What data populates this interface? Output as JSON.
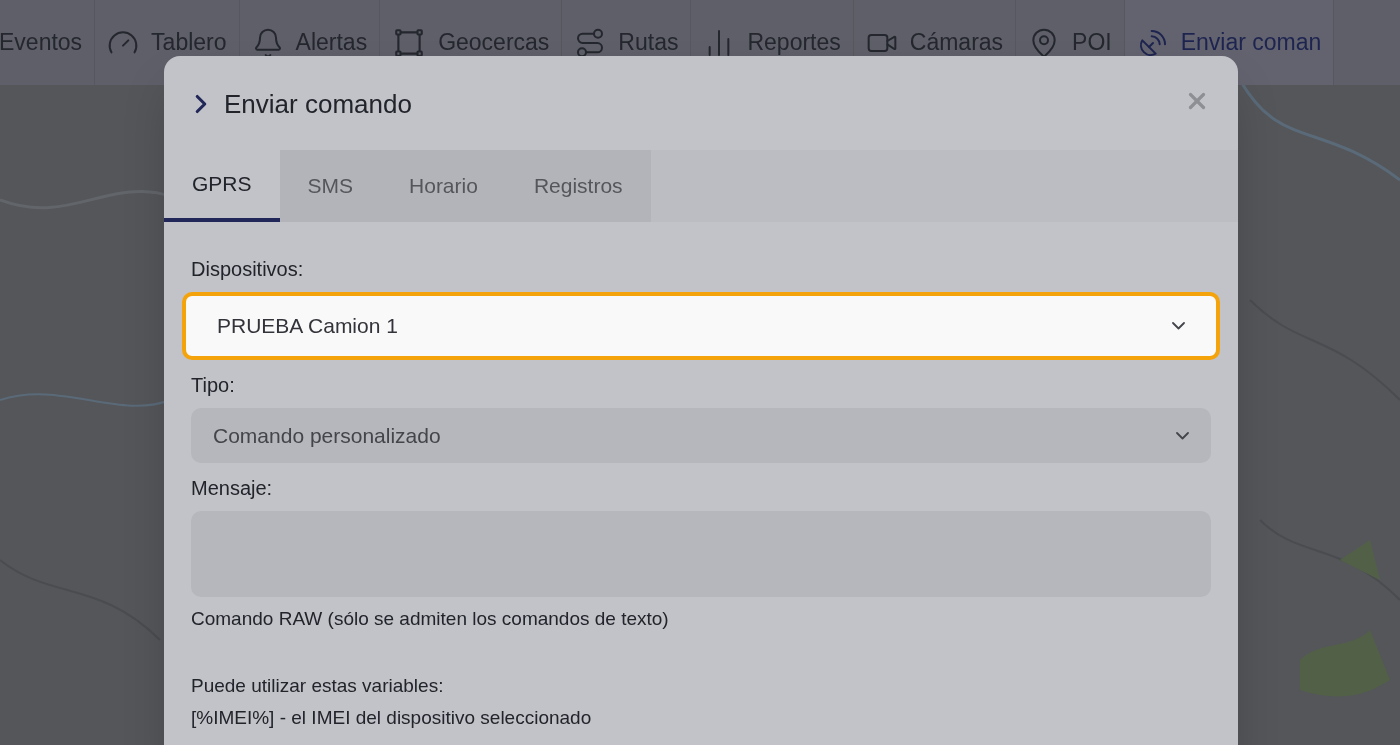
{
  "nav": {
    "items": [
      {
        "label": "Eventos",
        "selected": false
      },
      {
        "label": "Tablero",
        "selected": false
      },
      {
        "label": "Alertas",
        "selected": false
      },
      {
        "label": "Geocercas",
        "selected": false
      },
      {
        "label": "Rutas",
        "selected": false
      },
      {
        "label": "Reportes",
        "selected": false
      },
      {
        "label": "Cámaras",
        "selected": false
      },
      {
        "label": "POI",
        "selected": false
      },
      {
        "label": "Enviar coman",
        "selected": true
      }
    ]
  },
  "dialog": {
    "title": "Enviar comando",
    "tabs": [
      {
        "label": "GPRS",
        "selected": true
      },
      {
        "label": "SMS",
        "selected": false
      },
      {
        "label": "Horario",
        "selected": false
      },
      {
        "label": "Registros",
        "selected": false
      }
    ],
    "fields": [
      {
        "kind": "select",
        "label": "Dispositivos:",
        "value": "PRUEBA Camion 1",
        "focused": true
      },
      {
        "kind": "select",
        "label": "Tipo:",
        "value": "Comando personalizado",
        "focused": false
      },
      {
        "kind": "textarea",
        "label": "Mensaje:",
        "focused": false
      }
    ],
    "hint": "Comando RAW (sólo se admiten los comandos de texto)",
    "variables_title": "Puede utilizar estas variables:",
    "variables": [
      "[%IMEI%] - el IMEI del dispositivo seleccionado"
    ]
  }
}
